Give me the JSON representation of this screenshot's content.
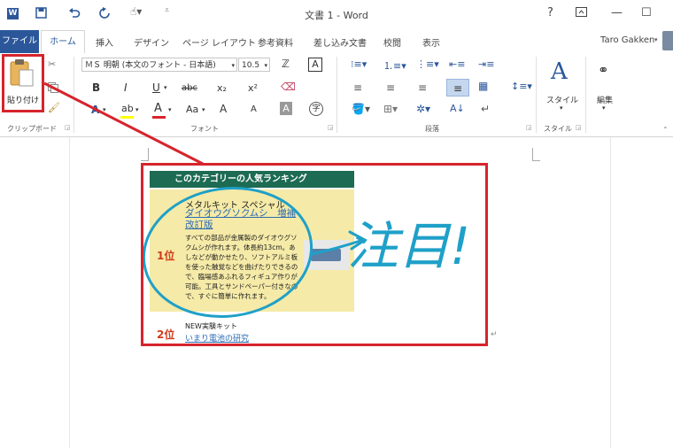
{
  "titlebar": {
    "title": "文書 1 - Word",
    "help": "?",
    "minimize": "—",
    "maximize": "☐",
    "app_icon": "W"
  },
  "tabs": [
    "ファイル",
    "ホーム",
    "挿入",
    "デザイン",
    "ページ レイアウト",
    "参考資料",
    "差し込み文書",
    "校閲",
    "表示"
  ],
  "user": "Taro Gakken",
  "clipboard": {
    "paste_label": "貼り付け",
    "group_label": "クリップボード"
  },
  "font": {
    "font_name": "ＭＳ 明朝 (本文のフォント - 日本語)",
    "font_size": "10.5",
    "group_label": "フォント",
    "bold": "B",
    "italic": "I",
    "underline": "U",
    "strike": "abc",
    "subscript": "x₂",
    "superscript": "x²",
    "change_case": "Aa",
    "grow": "A",
    "shrink": "A"
  },
  "paragraph": {
    "group_label": "段落"
  },
  "styles": {
    "label": "スタイル",
    "group_label": "スタイル"
  },
  "editing": {
    "label": "編集"
  },
  "image": {
    "header": "このカテゴリーの人気ランキング",
    "rank1": "1位",
    "rank2": "2位",
    "item1_sub": "メタルキット スペシャル",
    "item1_link": "ダイオウグソクムシ　増補改訂版",
    "item1_desc": "すべての部品が金属製のダイオウグソクムシが作れます。体長約13cm。あしなどが動かせたり、ソフトアルミ板を使った触覚などを曲げたりできるので、臨場感あふれるフィギュア作りが可能。工具とサンドペーパー付きなので、すぐに簡単に作れます。",
    "item2_sub": "NEW実験キット",
    "item2_link": "いまり電池の研究",
    "handwriting": "注目!"
  },
  "colors": {
    "word_blue": "#2b579a",
    "annotation_red": "#d6242c",
    "ink_blue": "#1fa0c8"
  }
}
